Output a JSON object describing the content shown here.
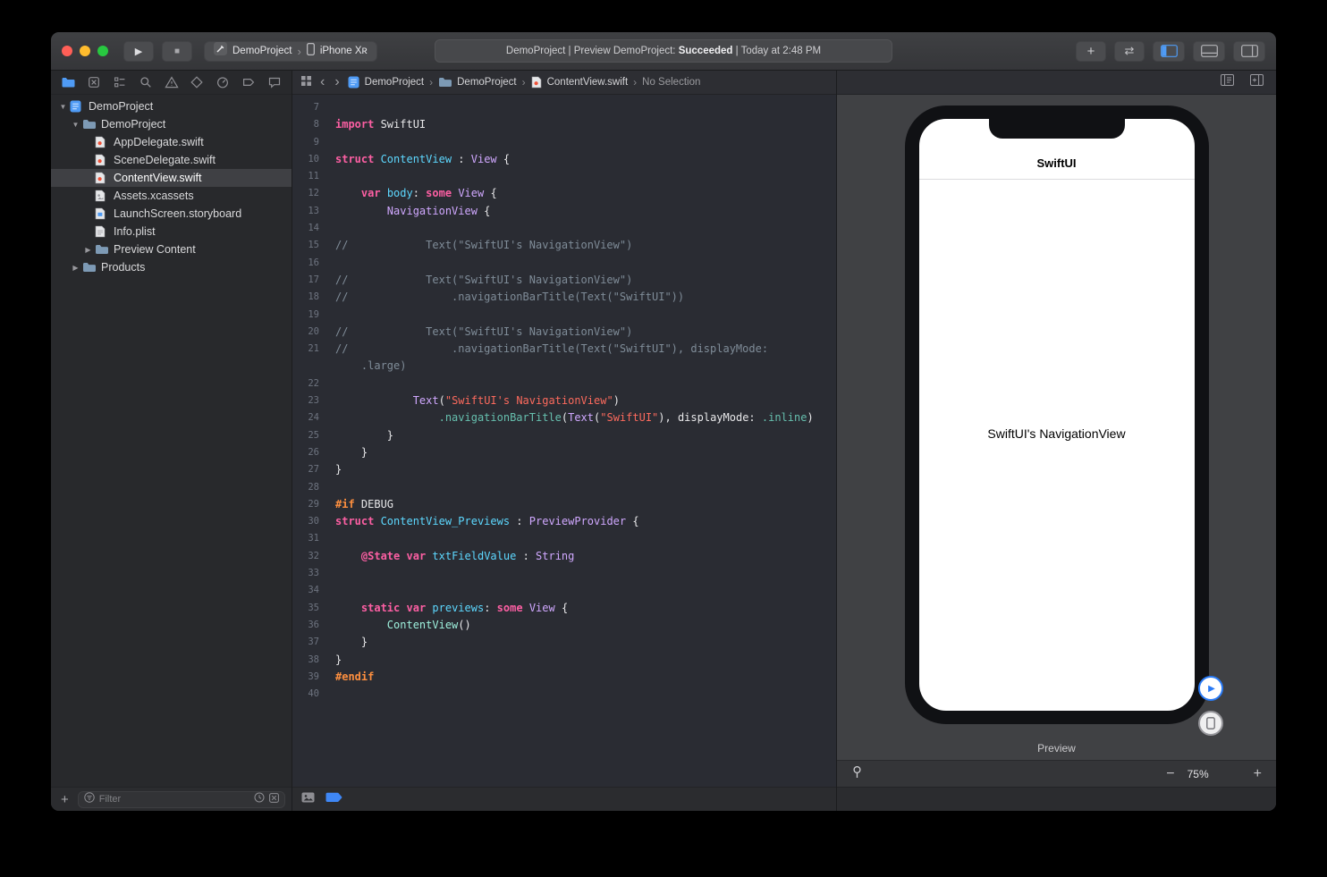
{
  "colors": {
    "accent_blue": "#4f9bf5",
    "breakpoint_blue": "#3f87f5",
    "traffic_red": "#ff5f57",
    "traffic_yellow": "#febc2e",
    "traffic_green": "#28c840"
  },
  "glyphs": {
    "play": "▶",
    "stop": "■",
    "add": "+",
    "swap": "⇄",
    "back": "‹",
    "forward": "›",
    "chevron": "›"
  },
  "toolbar": {
    "scheme": {
      "project": "DemoProject",
      "device": "iPhone Xʀ"
    },
    "status": {
      "prefix": "DemoProject | Preview DemoProject: ",
      "highlight": "Succeeded",
      "suffix": " | Today at 2:48 PM"
    }
  },
  "navigator": {
    "tabs": [
      "project",
      "source-control",
      "symbols",
      "find",
      "issues",
      "tests",
      "debug",
      "breakpoints",
      "reports"
    ],
    "active_tab": 0,
    "filter_placeholder": "Filter",
    "tree": [
      {
        "label": "DemoProject",
        "type": "project",
        "depth": 0,
        "disclosure": "open"
      },
      {
        "label": "DemoProject",
        "type": "folder",
        "depth": 1,
        "disclosure": "open"
      },
      {
        "label": "AppDelegate.swift",
        "type": "swift",
        "depth": 2
      },
      {
        "label": "SceneDelegate.swift",
        "type": "swift",
        "depth": 2
      },
      {
        "label": "ContentView.swift",
        "type": "swift",
        "depth": 2,
        "selected": true
      },
      {
        "label": "Assets.xcassets",
        "type": "assets",
        "depth": 2
      },
      {
        "label": "LaunchScreen.storyboard",
        "type": "storyboard",
        "depth": 2
      },
      {
        "label": "Info.plist",
        "type": "plist",
        "depth": 2
      },
      {
        "label": "Preview Content",
        "type": "folder",
        "depth": 2,
        "disclosure": "closed"
      },
      {
        "label": "Products",
        "type": "folder",
        "depth": 1,
        "disclosure": "closed"
      }
    ]
  },
  "jumpbar": {
    "crumbs": [
      {
        "label": "DemoProject",
        "icon": "project"
      },
      {
        "label": "DemoProject",
        "icon": "folder"
      },
      {
        "label": "ContentView.swift",
        "icon": "swift"
      },
      {
        "label": "No Selection",
        "icon": "none"
      }
    ]
  },
  "editor": {
    "lines": [
      {
        "n": "7",
        "tk": []
      },
      {
        "n": "8",
        "tk": [
          {
            "c": "k",
            "t": "import"
          },
          {
            "c": "p",
            "t": " SwiftUI"
          }
        ]
      },
      {
        "n": "9",
        "tk": []
      },
      {
        "n": "10",
        "tk": [
          {
            "c": "k",
            "t": "struct"
          },
          {
            "c": "d",
            "t": " ContentView"
          },
          {
            "c": "p",
            "t": " : "
          },
          {
            "c": "t",
            "t": "View"
          },
          {
            "c": "p",
            "t": " {"
          }
        ]
      },
      {
        "n": "11",
        "tk": []
      },
      {
        "n": "12",
        "tk": [
          {
            "c": "p",
            "t": "    "
          },
          {
            "c": "k",
            "t": "var"
          },
          {
            "c": "d",
            "t": " body"
          },
          {
            "c": "p",
            "t": ": "
          },
          {
            "c": "k",
            "t": "some"
          },
          {
            "c": "p",
            "t": " "
          },
          {
            "c": "t",
            "t": "View"
          },
          {
            "c": "p",
            "t": " {"
          }
        ]
      },
      {
        "n": "13",
        "tk": [
          {
            "c": "p",
            "t": "        "
          },
          {
            "c": "t",
            "t": "NavigationView"
          },
          {
            "c": "p",
            "t": " {"
          }
        ]
      },
      {
        "n": "14",
        "tk": []
      },
      {
        "n": "15",
        "tk": [
          {
            "c": "c",
            "t": "//            Text(\"SwiftUI's NavigationView\")"
          }
        ]
      },
      {
        "n": "16",
        "tk": []
      },
      {
        "n": "17",
        "tk": [
          {
            "c": "c",
            "t": "//            Text(\"SwiftUI's NavigationView\")"
          }
        ]
      },
      {
        "n": "18",
        "tk": [
          {
            "c": "c",
            "t": "//                .navigationBarTitle(Text(\"SwiftUI\"))"
          }
        ]
      },
      {
        "n": "19",
        "tk": []
      },
      {
        "n": "20",
        "tk": [
          {
            "c": "c",
            "t": "//            Text(\"SwiftUI's NavigationView\")"
          }
        ]
      },
      {
        "n": "21",
        "tk": [
          {
            "c": "c",
            "t": "//                .navigationBarTitle(Text(\"SwiftUI\"), displayMode:"
          }
        ]
      },
      {
        "n": "",
        "tk": [
          {
            "c": "c",
            "t": "    .large)"
          }
        ]
      },
      {
        "n": "22",
        "tk": []
      },
      {
        "n": "23",
        "tk": [
          {
            "c": "p",
            "t": "            "
          },
          {
            "c": "t",
            "t": "Text"
          },
          {
            "c": "p",
            "t": "("
          },
          {
            "c": "s",
            "t": "\"SwiftUI's NavigationView\""
          },
          {
            "c": "p",
            "t": ")"
          }
        ]
      },
      {
        "n": "24",
        "tk": [
          {
            "c": "p",
            "t": "                "
          },
          {
            "c": "f",
            "t": ".navigationBarTitle"
          },
          {
            "c": "p",
            "t": "("
          },
          {
            "c": "t",
            "t": "Text"
          },
          {
            "c": "p",
            "t": "("
          },
          {
            "c": "s",
            "t": "\"SwiftUI\""
          },
          {
            "c": "p",
            "t": "), displayMode: "
          },
          {
            "c": "f",
            "t": ".inline"
          },
          {
            "c": "p",
            "t": ")"
          }
        ]
      },
      {
        "n": "25",
        "tk": [
          {
            "c": "p",
            "t": "        }"
          }
        ]
      },
      {
        "n": "26",
        "tk": [
          {
            "c": "p",
            "t": "    }"
          }
        ]
      },
      {
        "n": "27",
        "tk": [
          {
            "c": "p",
            "t": "}"
          }
        ]
      },
      {
        "n": "28",
        "tk": []
      },
      {
        "n": "29",
        "tk": [
          {
            "c": "o",
            "t": "#if"
          },
          {
            "c": "p",
            "t": " DEBUG"
          }
        ]
      },
      {
        "n": "30",
        "tk": [
          {
            "c": "k",
            "t": "struct"
          },
          {
            "c": "d",
            "t": " ContentView_Previews"
          },
          {
            "c": "p",
            "t": " : "
          },
          {
            "c": "t",
            "t": "PreviewProvider"
          },
          {
            "c": "p",
            "t": " {"
          }
        ]
      },
      {
        "n": "31",
        "tk": []
      },
      {
        "n": "32",
        "tk": [
          {
            "c": "p",
            "t": "    "
          },
          {
            "c": "k",
            "t": "@State"
          },
          {
            "c": "p",
            "t": " "
          },
          {
            "c": "k",
            "t": "var"
          },
          {
            "c": "d",
            "t": " txtFieldValue"
          },
          {
            "c": "p",
            "t": " : "
          },
          {
            "c": "t",
            "t": "String"
          }
        ]
      },
      {
        "n": "33",
        "tk": []
      },
      {
        "n": "34",
        "tk": []
      },
      {
        "n": "35",
        "tk": [
          {
            "c": "p",
            "t": "    "
          },
          {
            "c": "k",
            "t": "static"
          },
          {
            "c": "p",
            "t": " "
          },
          {
            "c": "k",
            "t": "var"
          },
          {
            "c": "d",
            "t": " previews"
          },
          {
            "c": "p",
            "t": ": "
          },
          {
            "c": "k",
            "t": "some"
          },
          {
            "c": "p",
            "t": " "
          },
          {
            "c": "t",
            "t": "View"
          },
          {
            "c": "p",
            "t": " {"
          }
        ]
      },
      {
        "n": "36",
        "tk": [
          {
            "c": "p",
            "t": "        "
          },
          {
            "c": "m",
            "t": "ContentView"
          },
          {
            "c": "p",
            "t": "()"
          }
        ]
      },
      {
        "n": "37",
        "tk": [
          {
            "c": "p",
            "t": "    }"
          }
        ]
      },
      {
        "n": "38",
        "tk": [
          {
            "c": "p",
            "t": "}"
          }
        ]
      },
      {
        "n": "39",
        "tk": [
          {
            "c": "o",
            "t": "#endif"
          }
        ]
      },
      {
        "n": "40",
        "tk": []
      }
    ]
  },
  "preview": {
    "device_title": "SwiftUI",
    "device_body": "SwiftUI's NavigationView",
    "caption": "Preview",
    "zoom_out": "−",
    "zoom_level": "75%",
    "zoom_in": "+"
  }
}
